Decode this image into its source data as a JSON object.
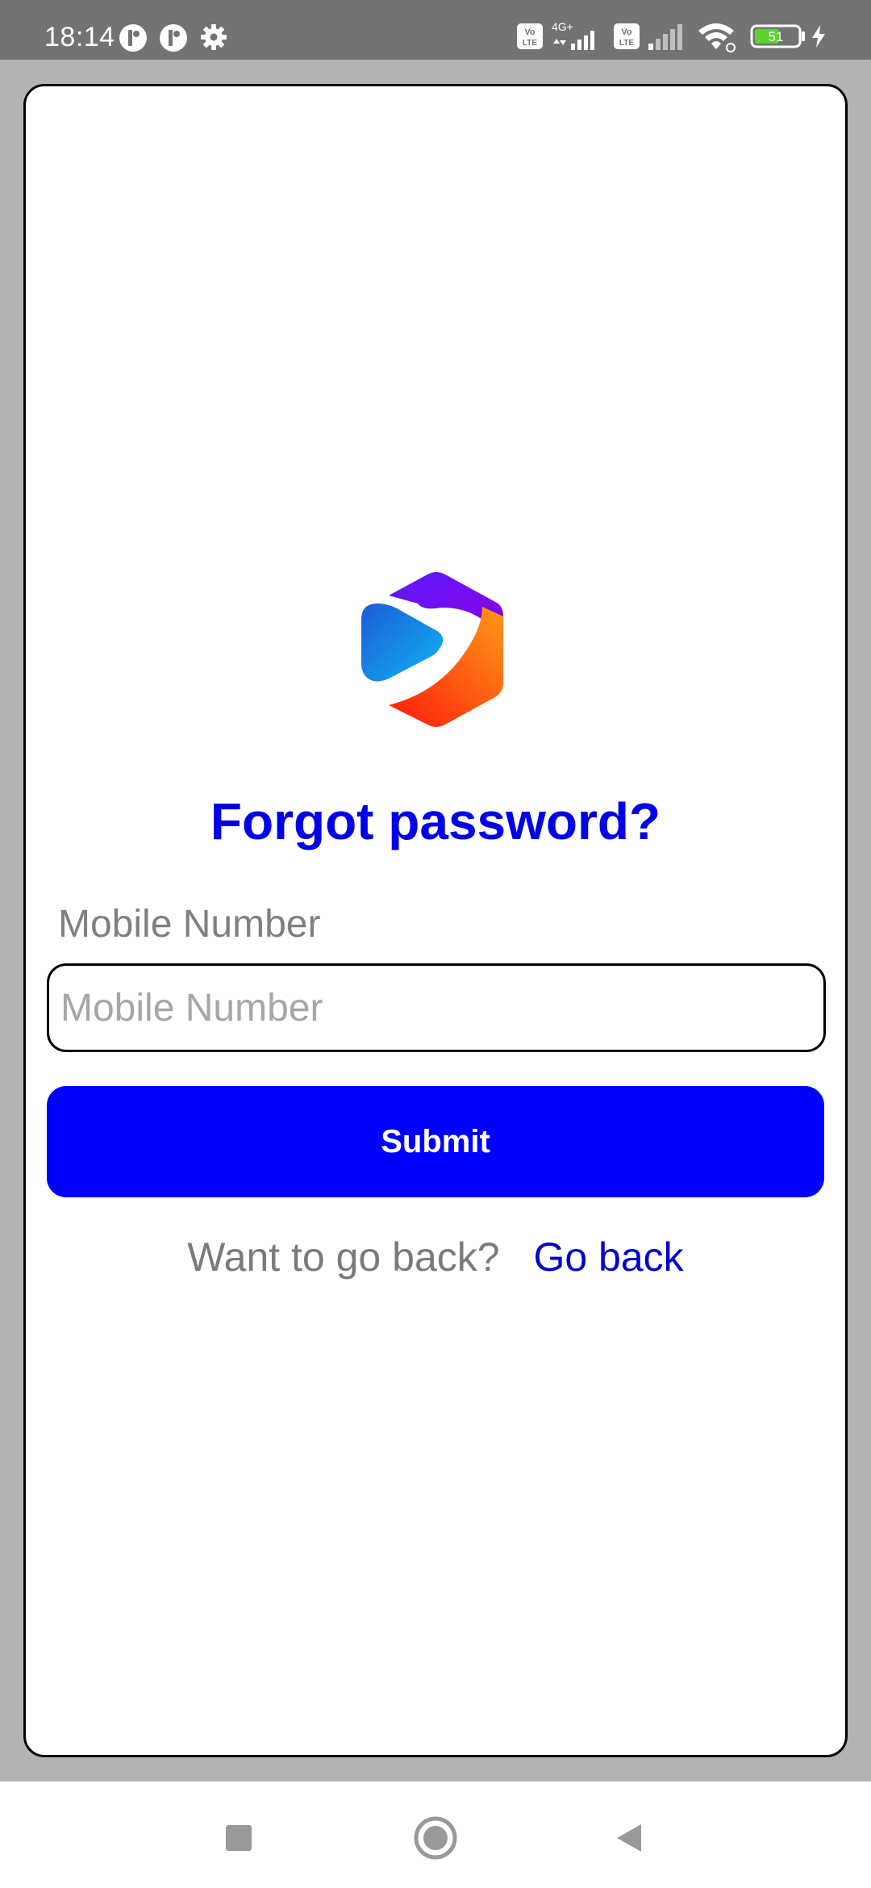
{
  "status_bar": {
    "time": "18:14",
    "left_icons": [
      "app-notification-icon",
      "app-notification-icon",
      "settings-gear-icon"
    ],
    "right_icons": [
      "volte-icon",
      "network-4g-icon",
      "signal-icon",
      "volte-icon",
      "signal-icon",
      "wifi-icon",
      "battery-icon",
      "charging-icon"
    ],
    "network_type": "4G+",
    "volte_label": "Vo LTE",
    "battery_level": "51"
  },
  "page": {
    "title": "Forgot password?",
    "field_label": "Mobile Number",
    "input_value": "",
    "input_placeholder": "Mobile Number",
    "submit_label": "Submit",
    "back_prompt": "Want to go back?",
    "back_link": "Go back"
  },
  "nav_bar": {
    "buttons": [
      "recents-square-icon",
      "home-circle-icon",
      "back-triangle-icon"
    ]
  },
  "colors": {
    "accent_blue": "#0000ff",
    "title_blue": "#0000e6",
    "link_blue": "#0000cc",
    "status_bar_bg": "#737373",
    "backdrop_gray": "#b3b3b3",
    "battery_green": "#5bd22e"
  }
}
